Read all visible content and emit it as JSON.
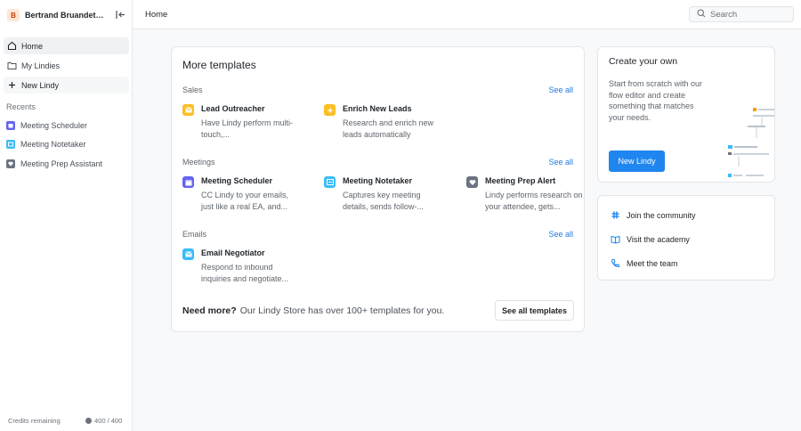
{
  "sidebar": {
    "workspace_initial": "B",
    "workspace_name": "Bertrand Bruandet's...",
    "nav": [
      {
        "label": "Home"
      },
      {
        "label": "My Lindies"
      },
      {
        "label": "New Lindy"
      }
    ],
    "recents_title": "Recents",
    "recents": [
      {
        "label": "Meeting Scheduler",
        "color": "#6366f1"
      },
      {
        "label": "Meeting Notetaker",
        "color": "#38bdf8"
      },
      {
        "label": "Meeting Prep Assistant",
        "color": "#6b7280"
      }
    ],
    "credits_label": "Credits remaining",
    "credits_value": "400 / 400"
  },
  "header": {
    "title": "Home",
    "search_placeholder": "Search"
  },
  "templates": {
    "title": "More templates",
    "see_all_label": "See all",
    "sections": [
      {
        "label": "Sales",
        "items": [
          {
            "name": "Lead Outreacher",
            "desc": "Have Lindy perform multi-touch,...",
            "icon": "mail-icon",
            "color": "#fbbf24"
          },
          {
            "name": "Enrich New Leads",
            "desc": "Research and enrich new leads automatically",
            "icon": "sparkle-icon",
            "color": "#fbbf24"
          }
        ]
      },
      {
        "label": "Meetings",
        "items": [
          {
            "name": "Meeting Scheduler",
            "desc": "CC Lindy to your emails, just like a real EA, and...",
            "icon": "calendar-icon",
            "color": "#6366f1"
          },
          {
            "name": "Meeting Notetaker",
            "desc": "Captures key meeting details, sends follow-...",
            "icon": "notes-icon",
            "color": "#38bdf8"
          },
          {
            "name": "Meeting Prep Alert",
            "desc": "Lindy performs research on your attendee, gets...",
            "icon": "heart-icon",
            "color": "#6b7280"
          }
        ]
      },
      {
        "label": "Emails",
        "items": [
          {
            "name": "Email Negotiator",
            "desc": "Respond to inbound inquiries and negotiate...",
            "icon": "mail-icon",
            "color": "#38bdf8"
          }
        ]
      }
    ],
    "need_more_bold": "Need more?",
    "need_more_text": "Our Lindy Store has over 100+ templates for you.",
    "see_all_templates_label": "See all templates"
  },
  "create": {
    "title": "Create your own",
    "desc": "Start from scratch with our flow editor and create something that matches your needs.",
    "button_label": "New Lindy"
  },
  "links": [
    {
      "label": "Join the community",
      "icon": "slack-icon"
    },
    {
      "label": "Visit the academy",
      "icon": "book-icon"
    },
    {
      "label": "Meet the team",
      "icon": "phone-icon"
    }
  ],
  "colors": {
    "accent": "#1f86f0",
    "link": "#1f7ae0"
  }
}
